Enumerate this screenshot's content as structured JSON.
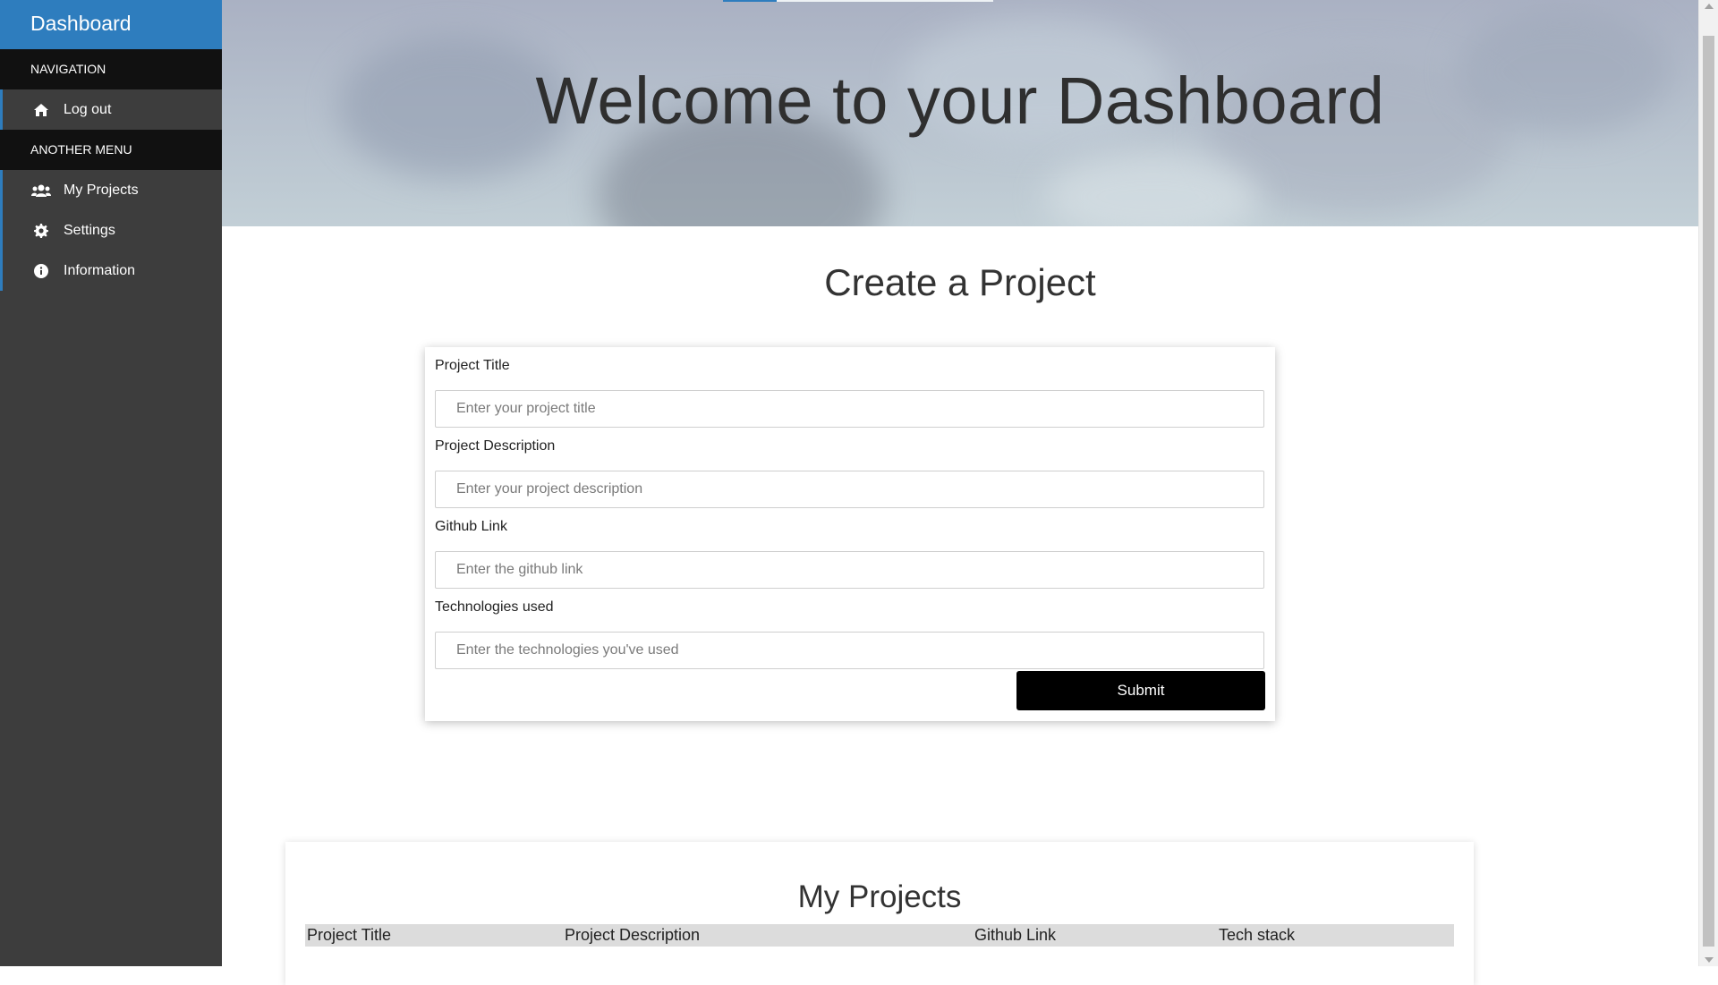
{
  "sidebar": {
    "brand": "Dashboard",
    "sections": [
      {
        "header": "NAVIGATION",
        "items": [
          {
            "label": "Log out",
            "icon": "home-icon"
          }
        ]
      },
      {
        "header": "ANOTHER MENU",
        "items": [
          {
            "label": "My Projects",
            "icon": "users-icon"
          },
          {
            "label": "Settings",
            "icon": "gear-icon"
          },
          {
            "label": "Information",
            "icon": "info-icon"
          }
        ]
      }
    ]
  },
  "hero": {
    "title": "Welcome to your Dashboard"
  },
  "create": {
    "title": "Create a Project",
    "fields": [
      {
        "label": "Project Title",
        "placeholder": "Enter your project title"
      },
      {
        "label": "Project Description",
        "placeholder": "Enter your project description"
      },
      {
        "label": "Github Link",
        "placeholder": "Enter the github link"
      },
      {
        "label": "Technologies used",
        "placeholder": "Enter the technologies you've used"
      }
    ],
    "submit_label": "Submit"
  },
  "projects": {
    "title": "My Projects",
    "columns": [
      "Project Title",
      "Project Description",
      "Github Link",
      "Tech stack"
    ]
  },
  "colors": {
    "brand": "#2e7dbe",
    "sidebar_bg": "#3d3d3d",
    "section_header_bg": "#111111",
    "button_bg": "#000000"
  }
}
